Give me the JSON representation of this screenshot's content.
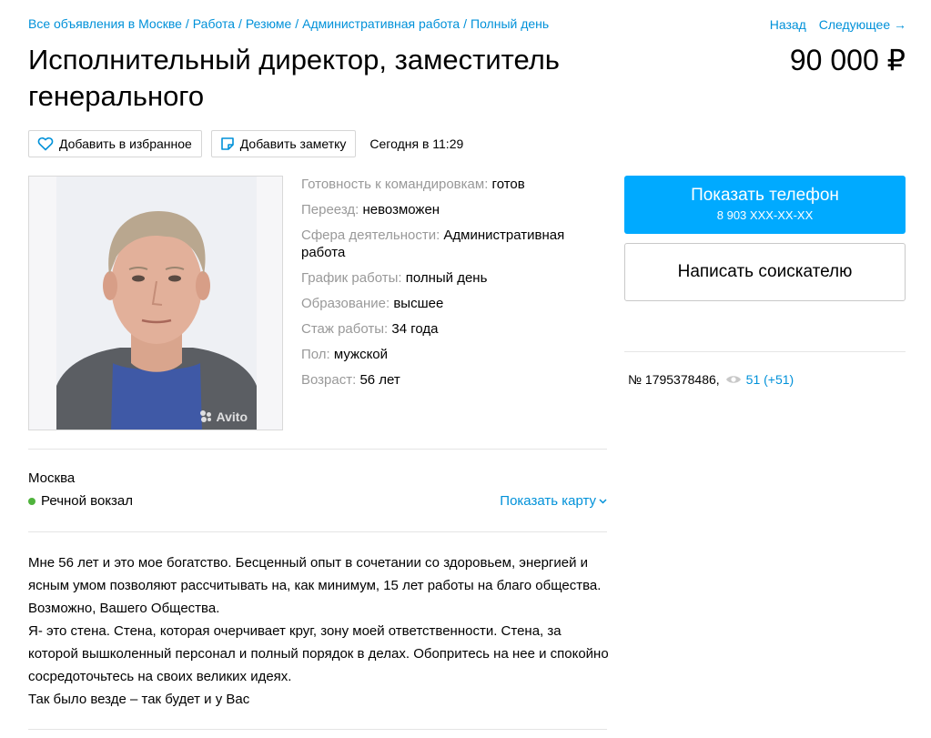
{
  "breadcrumbs": [
    "Все объявления в Москве",
    "Работа",
    "Резюме",
    "Административная работа",
    "Полный день"
  ],
  "breadcrumb_separator": "/",
  "nav": {
    "back": "Назад",
    "next": "Следующее →"
  },
  "title": "Исполнительный директор, заместитель генерального",
  "price": "90 000 ₽",
  "actions": {
    "favorite": "Добавить в избранное",
    "note": "Добавить заметку",
    "date": "Сегодня в 11:29"
  },
  "photo": {
    "watermark": "Avito"
  },
  "params": [
    {
      "key": "Готовность к командировкам:",
      "value": "готов"
    },
    {
      "key": "Переезд:",
      "value": "невозможен"
    },
    {
      "key": "Сфера деятельности:",
      "value": "Административная работа"
    },
    {
      "key": "График работы:",
      "value": "полный день"
    },
    {
      "key": "Образование:",
      "value": "высшее"
    },
    {
      "key": "Стаж работы:",
      "value": "34 года"
    },
    {
      "key": "Пол:",
      "value": "мужской"
    },
    {
      "key": "Возраст:",
      "value": "56 лет"
    }
  ],
  "contact": {
    "show_phone": "Показать телефон",
    "phone_masked": "8 903 XXX-XX-XX",
    "write": "Написать соискателю"
  },
  "meta": {
    "id": "№ 1795378486,",
    "views": "51 (+51)"
  },
  "location": {
    "city": "Москва",
    "metro": "Речной вокзал",
    "show_map": "Показать карту"
  },
  "description": [
    "Мне 56 лет и это мое богатство. Бесценный опыт в сочетании со здоровьем, энергией и ясным умом позволяют рассчитывать на, как минимум, 15 лет работы на благо общества. Возможно, Вашего Общества.",
    "Я- это стена. Стена, которая очерчивает круг, зону моей ответственности. Стена, за которой вышколенный персонал и полный порядок в делах. Обопритесь на нее и спокойно сосредоточьтесь на своих великих идеях.",
    "Так было везде – так будет и у Вас"
  ],
  "colors": {
    "link": "#0091d9",
    "accent_button": "#00aaff",
    "metro_line": "#4fb33c",
    "muted_text": "#999999"
  },
  "icons": [
    "heart-icon",
    "note-icon",
    "eye-icon",
    "chevron-down-icon"
  ]
}
